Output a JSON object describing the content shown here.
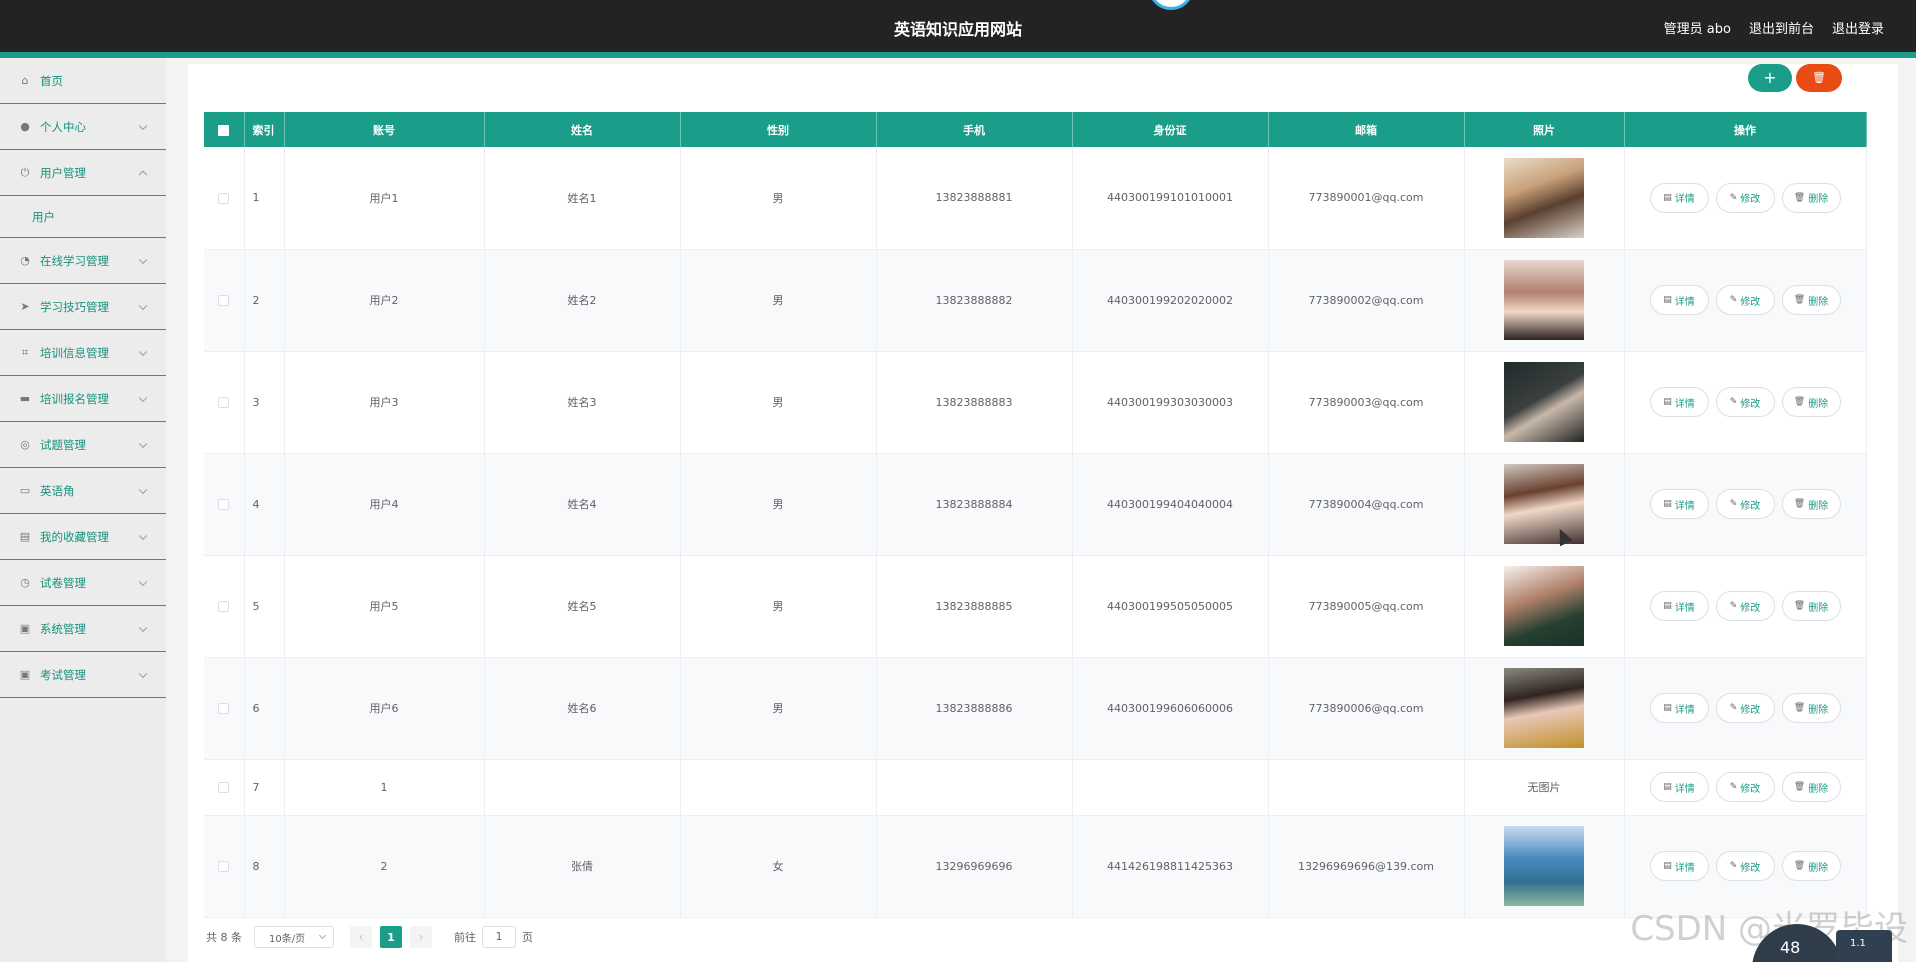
{
  "header": {
    "title": "英语知识应用网站",
    "admin_label": "管理员 abo",
    "front_label": "退出到前台",
    "logout_label": "退出登录"
  },
  "sidebar": {
    "items": [
      {
        "label": "首页",
        "icon": "home-icon"
      },
      {
        "label": "个人中心",
        "icon": "user-icon"
      },
      {
        "label": "用户管理",
        "icon": "power-icon"
      },
      {
        "label": "在线学习管理",
        "icon": "dashboard-icon"
      },
      {
        "label": "学习技巧管理",
        "icon": "send-icon"
      },
      {
        "label": "培训信息管理",
        "icon": "crop-icon"
      },
      {
        "label": "培训报名管理",
        "icon": "chat-icon"
      },
      {
        "label": "试题管理",
        "icon": "target-icon"
      },
      {
        "label": "英语角",
        "icon": "briefcase-icon"
      },
      {
        "label": "我的收藏管理",
        "icon": "printer-icon"
      },
      {
        "label": "试卷管理",
        "icon": "clock-icon"
      },
      {
        "label": "系统管理",
        "icon": "clipboard-icon"
      },
      {
        "label": "考试管理",
        "icon": "clipboard-check-icon"
      }
    ],
    "sub_user": "用户"
  },
  "toolbar": {
    "add_label": "+",
    "delete_label": "🗑"
  },
  "table": {
    "headers": [
      "索引",
      "账号",
      "姓名",
      "性别",
      "手机",
      "身份证",
      "邮箱",
      "照片",
      "操作"
    ],
    "rows": [
      {
        "index": "1",
        "account": "用户1",
        "name": "姓名1",
        "gender": "男",
        "phone": "13823888881",
        "idcard": "440300199101010001",
        "email": "773890001@qq.com",
        "photo": "p1"
      },
      {
        "index": "2",
        "account": "用户2",
        "name": "姓名2",
        "gender": "男",
        "phone": "13823888882",
        "idcard": "440300199202020002",
        "email": "773890002@qq.com",
        "photo": "p2"
      },
      {
        "index": "3",
        "account": "用户3",
        "name": "姓名3",
        "gender": "男",
        "phone": "13823888883",
        "idcard": "440300199303030003",
        "email": "773890003@qq.com",
        "photo": "p3"
      },
      {
        "index": "4",
        "account": "用户4",
        "name": "姓名4",
        "gender": "男",
        "phone": "13823888884",
        "idcard": "440300199404040004",
        "email": "773890004@qq.com",
        "photo": "p4"
      },
      {
        "index": "5",
        "account": "用户5",
        "name": "姓名5",
        "gender": "男",
        "phone": "13823888885",
        "idcard": "440300199505050005",
        "email": "773890005@qq.com",
        "photo": "p5"
      },
      {
        "index": "6",
        "account": "用户6",
        "name": "姓名6",
        "gender": "男",
        "phone": "13823888886",
        "idcard": "440300199606060006",
        "email": "773890006@qq.com",
        "photo": "p6"
      },
      {
        "index": "7",
        "account": "1",
        "name": "",
        "gender": "",
        "phone": "",
        "idcard": "",
        "email": "",
        "photo": "",
        "no_photo": "无图片"
      },
      {
        "index": "8",
        "account": "2",
        "name": "张倩",
        "gender": "女",
        "phone": "13296969696",
        "idcard": "441426198811425363",
        "email": "13296969696@139.com",
        "photo": "p8"
      }
    ],
    "actions": {
      "detail": "详情",
      "edit": "修改",
      "delete": "删除"
    }
  },
  "pagination": {
    "total": "共 8 条",
    "page_size": "10条/页",
    "current": "1",
    "goto_label": "前往",
    "goto_value": "1",
    "page_suffix": "页"
  },
  "overlay": {
    "watermark": "CSDN @米罗毕设",
    "speed_main": "48",
    "speed_small": "1.1"
  },
  "colors": {
    "accent": "#1a9e89",
    "danger": "#ea4a14",
    "topbar": "#232323"
  }
}
